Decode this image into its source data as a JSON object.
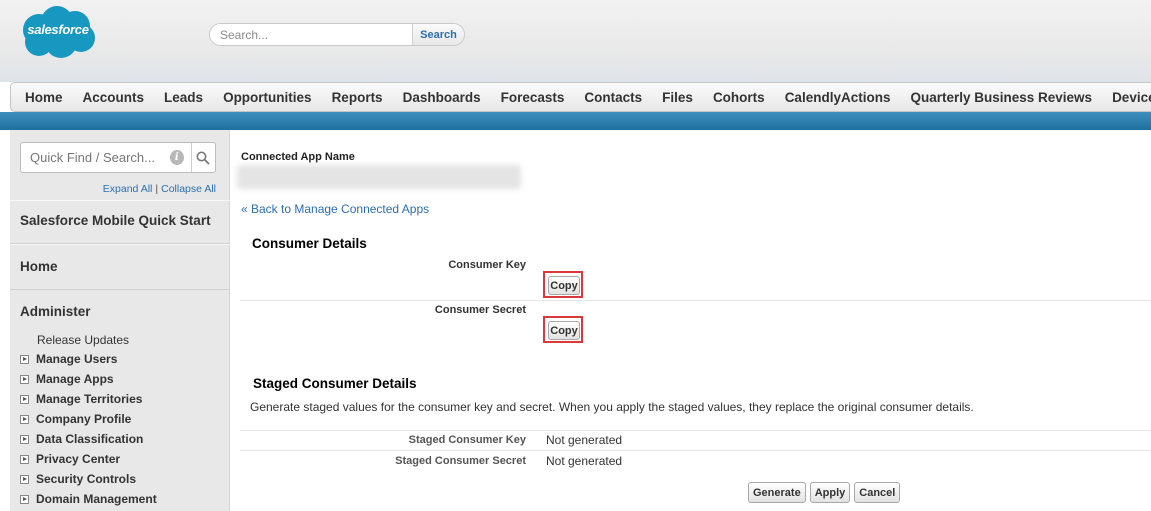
{
  "header": {
    "logo_text": "salesforce",
    "search_placeholder": "Search...",
    "search_button": "Search"
  },
  "colors": {
    "brand": "#1798c1",
    "link": "#2a6fb2",
    "highlight": "#d9383d",
    "nav_strip": "#2a7fb0"
  },
  "nav": {
    "tabs": [
      "Home",
      "Accounts",
      "Leads",
      "Opportunities",
      "Reports",
      "Dashboards",
      "Forecasts",
      "Contacts",
      "Files",
      "Cohorts",
      "CalendlyActions",
      "Quarterly Business Reviews",
      "Device Tiers"
    ]
  },
  "sidebar": {
    "quick_find_placeholder": "Quick Find / Search...",
    "expand_all": "Expand All",
    "separator": "|",
    "collapse_all": "Collapse All",
    "mobile_quick_start": "Salesforce Mobile Quick Start",
    "home": "Home",
    "administer": "Administer",
    "release_updates": "Release Updates",
    "items": [
      "Manage Users",
      "Manage Apps",
      "Manage Territories",
      "Company Profile",
      "Data Classification",
      "Privacy Center",
      "Security Controls",
      "Domain Management"
    ]
  },
  "main": {
    "app_name_label": "Connected App Name",
    "back_link": "« Back to Manage Connected Apps",
    "consumer_details": {
      "title": "Consumer Details",
      "key_label": "Consumer Key",
      "secret_label": "Consumer Secret",
      "copy_label": "Copy"
    },
    "staged": {
      "title": "Staged Consumer Details",
      "description": "Generate staged values for the consumer key and secret. When you apply the staged values, they replace the original consumer details.",
      "key_label": "Staged Consumer Key",
      "key_value": "Not generated",
      "secret_label": "Staged Consumer Secret",
      "secret_value": "Not generated"
    },
    "buttons": {
      "generate": "Generate",
      "apply": "Apply",
      "cancel": "Cancel"
    }
  }
}
